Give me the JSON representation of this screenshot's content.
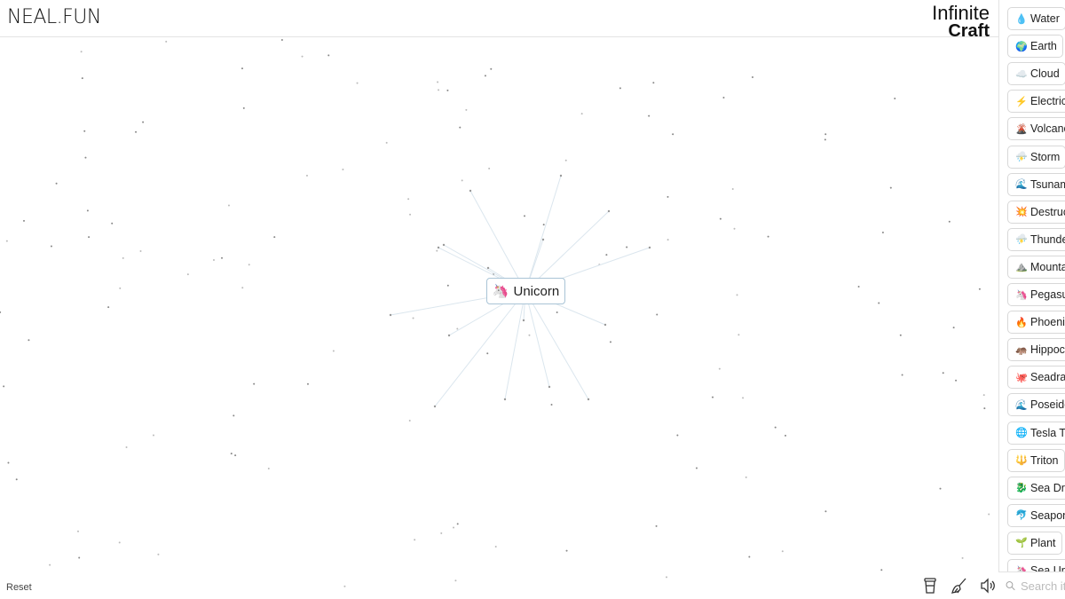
{
  "header": {
    "logo": "NEAL.FUN",
    "brand_line1": "Infinite",
    "brand_line2": "Craft"
  },
  "canvas_node": {
    "label": "Unicorn",
    "emoji": "🦄"
  },
  "footer": {
    "reset": "Reset",
    "icons": [
      "coffee-cup-icon",
      "broom-icon",
      "speaker-icon"
    ]
  },
  "sidebar": {
    "items": [
      {
        "emoji": "💧",
        "label": "Water"
      },
      {
        "emoji": "🌍",
        "label": "Earth"
      },
      {
        "emoji": "☁️",
        "label": "Cloud"
      },
      {
        "emoji": "⚡",
        "label": "Electricity"
      },
      {
        "emoji": "🌋",
        "label": "Volcano"
      },
      {
        "emoji": "⛈️",
        "label": "Storm"
      },
      {
        "emoji": "🌊",
        "label": "Tsunami"
      },
      {
        "emoji": "💥",
        "label": "Destruction"
      },
      {
        "emoji": "⛈️",
        "label": "Thunderstorm"
      },
      {
        "emoji": "⛰️",
        "label": "Mountain"
      },
      {
        "emoji": "🦄",
        "label": "Pegasus"
      },
      {
        "emoji": "🔥",
        "label": "Phoenix"
      },
      {
        "emoji": "🦛",
        "label": "Hippocampus"
      },
      {
        "emoji": "🐙",
        "label": "Seadragon"
      },
      {
        "emoji": "🌊",
        "label": "Poseidon"
      },
      {
        "emoji": "🌐",
        "label": "Tesla Tower"
      },
      {
        "emoji": "🔱",
        "label": "Triton"
      },
      {
        "emoji": "🐉",
        "label": "Sea Dragon"
      },
      {
        "emoji": "🐬",
        "label": "Seapony"
      },
      {
        "emoji": "🌱",
        "label": "Plant"
      },
      {
        "emoji": "🦄",
        "label": "Sea Unicorn"
      }
    ]
  },
  "search": {
    "placeholder": "Search items..."
  }
}
